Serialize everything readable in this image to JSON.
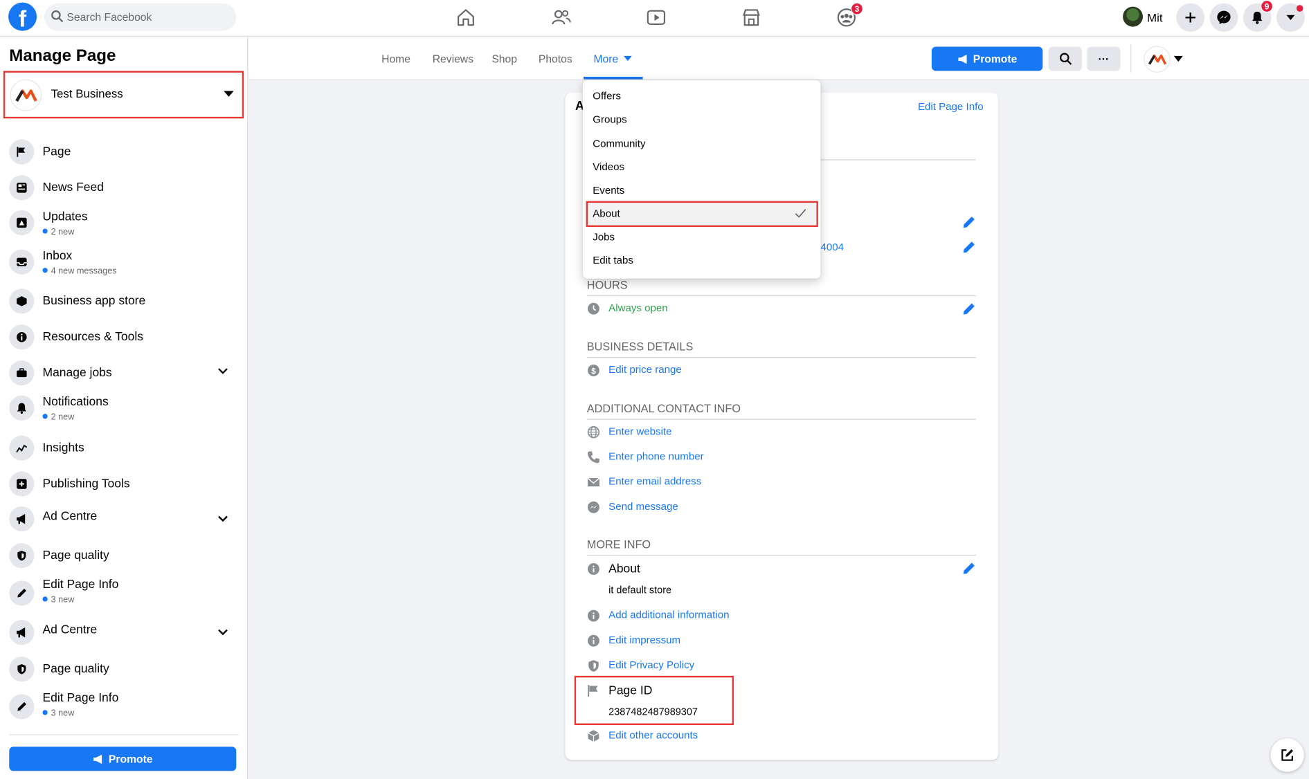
{
  "topbar": {
    "search_placeholder": "Search Facebook",
    "groups_badge": "3",
    "notifications_badge": "9",
    "user_name": "Mit"
  },
  "sidebar": {
    "title": "Manage Page",
    "business_name": "Test Business",
    "items": [
      {
        "label": "Page",
        "sub": ""
      },
      {
        "label": "News Feed",
        "sub": ""
      },
      {
        "label": "Updates",
        "sub": "2 new"
      },
      {
        "label": "Inbox",
        "sub": "4 new messages"
      },
      {
        "label": "Business app store",
        "sub": ""
      },
      {
        "label": "Resources & Tools",
        "sub": ""
      },
      {
        "label": "Manage jobs",
        "sub": ""
      },
      {
        "label": "Notifications",
        "sub": "2 new"
      },
      {
        "label": "Insights",
        "sub": ""
      },
      {
        "label": "Publishing Tools",
        "sub": ""
      },
      {
        "label": "Ad Centre",
        "sub": ""
      },
      {
        "label": "Page quality",
        "sub": ""
      },
      {
        "label": "Edit Page Info",
        "sub": "3 new"
      },
      {
        "label": "Ad Centre",
        "sub": ""
      },
      {
        "label": "Page quality",
        "sub": ""
      },
      {
        "label": "Edit Page Info",
        "sub": "3 new"
      }
    ],
    "promote_label": "Promote"
  },
  "tabs": {
    "items": [
      "Home",
      "Reviews",
      "Shop",
      "Photos",
      "More"
    ],
    "promote_label": "Promote",
    "more_button": "···"
  },
  "dropdown": {
    "items": [
      "Offers",
      "Groups",
      "Community",
      "Videos",
      "Events",
      "About",
      "Jobs",
      "Edit tabs"
    ]
  },
  "about": {
    "header_partial": "A",
    "edit_page_info": "Edit Page Info",
    "partial_number": "4004",
    "hours_heading": "HOURS",
    "hours_value": "Always open",
    "business_details_heading": "BUSINESS DETAILS",
    "price_range": "Edit price range",
    "additional_contact_heading": "ADDITIONAL CONTACT INFO",
    "website": "Enter website",
    "phone": "Enter phone number",
    "email": "Enter email address",
    "send_message": "Send message",
    "more_info_heading": "MORE INFO",
    "about_label": "About",
    "about_value": "it default store",
    "add_info": "Add additional information",
    "impressum": "Edit impressum",
    "privacy": "Edit Privacy Policy",
    "page_id_label": "Page ID",
    "page_id_value": "2387482487989307",
    "other_accounts": "Edit other accounts"
  },
  "colors": {
    "brand_blue": "#1877f2",
    "highlight_red": "#e53935",
    "open_green": "#31a24c"
  }
}
